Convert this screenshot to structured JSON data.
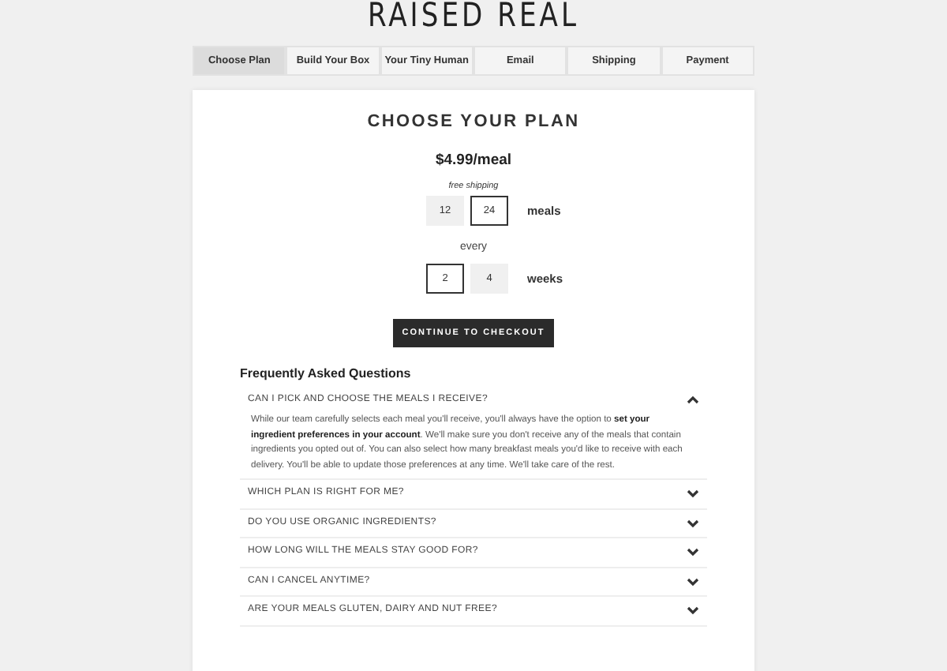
{
  "logo": "RAISED REAL",
  "tabs": [
    {
      "label": "Choose Plan",
      "selected": true
    },
    {
      "label": "Build Your Box",
      "selected": false
    },
    {
      "label": "Your Tiny Human",
      "selected": false
    },
    {
      "label": "Email",
      "selected": false
    },
    {
      "label": "Shipping",
      "selected": false
    },
    {
      "label": "Payment",
      "selected": false
    }
  ],
  "title": "CHOOSE YOUR PLAN",
  "price": "$4.99/meal",
  "price_note": "free shipping",
  "meal_options": [
    {
      "label": "12",
      "selected": false
    },
    {
      "label": "24",
      "selected": true
    }
  ],
  "meal_unit": "meals",
  "connector": "every",
  "week_options": [
    {
      "label": "2",
      "selected": true
    },
    {
      "label": "4",
      "selected": false
    }
  ],
  "week_unit": "weeks",
  "checkout_button": "CONTINUE TO CHECKOUT",
  "faq_title": "Frequently Asked Questions",
  "faq": [
    {
      "question": "CAN I PICK AND CHOOSE THE MEALS I RECEIVE?",
      "expanded": true,
      "answer": "While our team carefully selects each meal you'll receive, you'll always have the option to **set your ingredient preferences in your account**. We'll make sure you don't receive any of the meals that contain ingredients you opted out of. You can also select how many breakfast meals you'd like to receive with each delivery. You'll be able to update those preferences at any time. We'll take care of the rest."
    },
    {
      "question": "WHICH PLAN IS RIGHT FOR ME?",
      "expanded": false
    },
    {
      "question": "DO YOU USE ORGANIC INGREDIENTS?",
      "expanded": false
    },
    {
      "question": "HOW LONG WILL THE MEALS STAY GOOD FOR?",
      "expanded": false
    },
    {
      "question": "CAN I CANCEL ANYTIME?",
      "expanded": false
    },
    {
      "question": "ARE YOUR MEALS GLUTEN, DAIRY AND NUT FREE?",
      "expanded": false
    }
  ]
}
